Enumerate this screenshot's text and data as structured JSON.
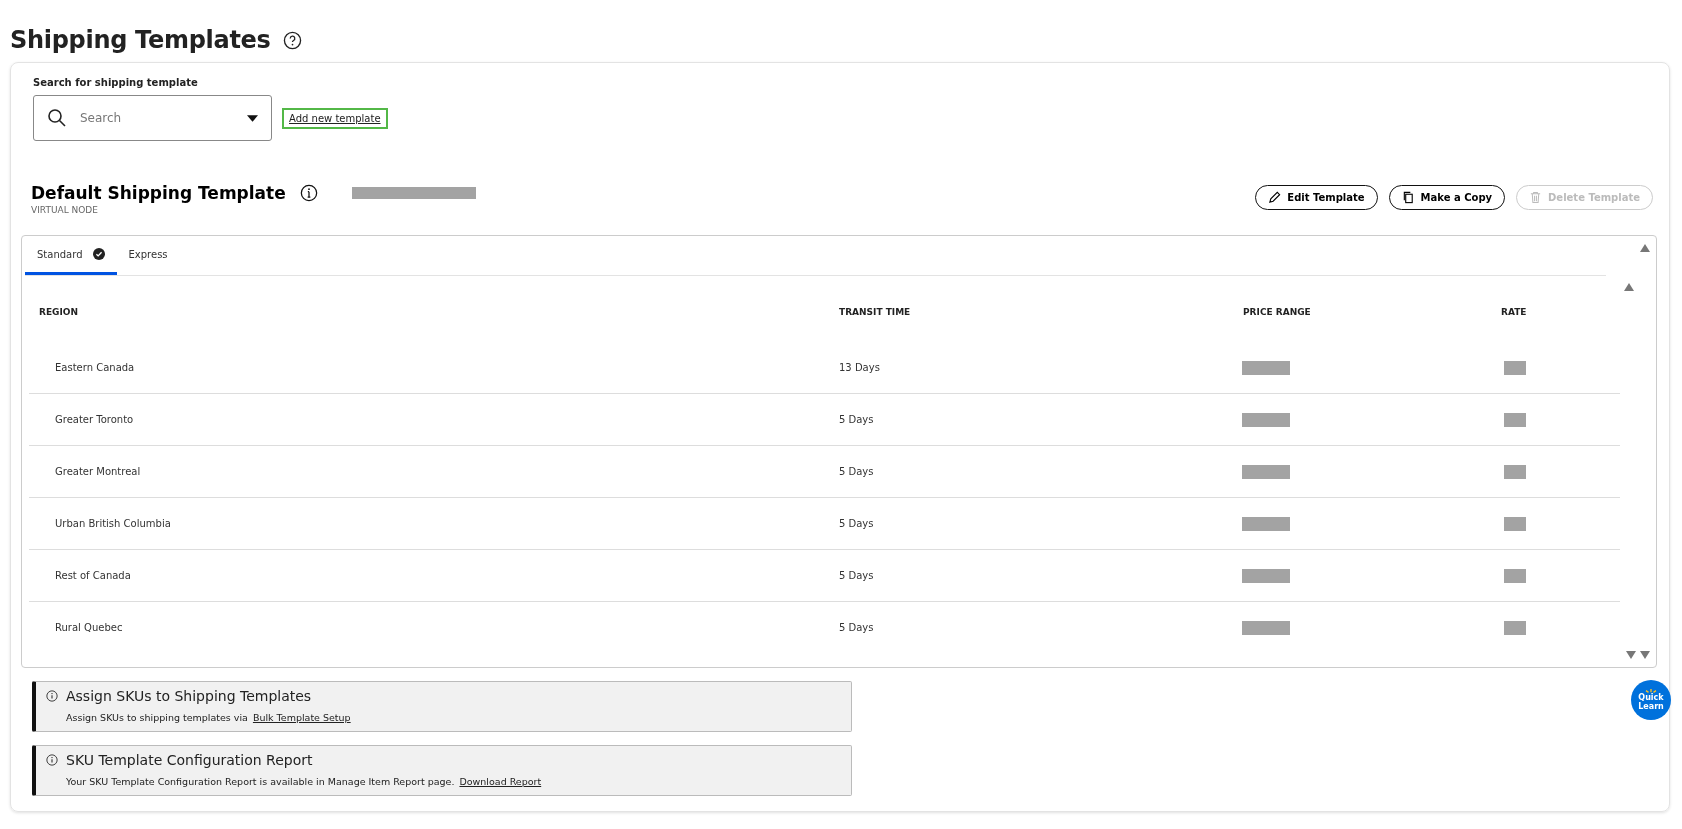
{
  "page_title": "Shipping Templates",
  "search": {
    "label": "Search for shipping template",
    "placeholder": "Search"
  },
  "add_link": "Add new template",
  "template": {
    "title": "Default Shipping Template",
    "subtitle": "VIRTUAL NODE"
  },
  "actions": [
    {
      "label": "Edit Template",
      "kind": "edit",
      "disabled": false
    },
    {
      "label": "Make a Copy",
      "kind": "copy",
      "disabled": false
    },
    {
      "label": "Delete Template",
      "kind": "delete",
      "disabled": true
    }
  ],
  "tabs": [
    {
      "label": "Standard",
      "selected": true,
      "checked": true
    },
    {
      "label": "Express",
      "selected": false,
      "checked": false
    }
  ],
  "table": {
    "columns": [
      "REGION",
      "TRANSIT TIME",
      "PRICE RANGE",
      "RATE"
    ],
    "rows": [
      {
        "region": "Eastern Canada",
        "transit": "13 Days"
      },
      {
        "region": "Greater Toronto",
        "transit": "5 Days"
      },
      {
        "region": "Greater Montreal",
        "transit": "5 Days"
      },
      {
        "region": "Urban British Columbia",
        "transit": "5 Days"
      },
      {
        "region": "Rest of Canada",
        "transit": "5 Days"
      },
      {
        "region": "Rural Quebec",
        "transit": "5 Days"
      }
    ]
  },
  "notices": [
    {
      "title": "Assign SKUs to Shipping Templates",
      "text": "Assign SKUs to shipping templates via",
      "link": "Bulk Template Setup"
    },
    {
      "title": "SKU Template Configuration Report",
      "text": "Your SKU Template Configuration Report is available in Manage Item Report page.",
      "link": "Download Report"
    }
  ],
  "quick_learn": [
    "Quick",
    "Learn"
  ]
}
